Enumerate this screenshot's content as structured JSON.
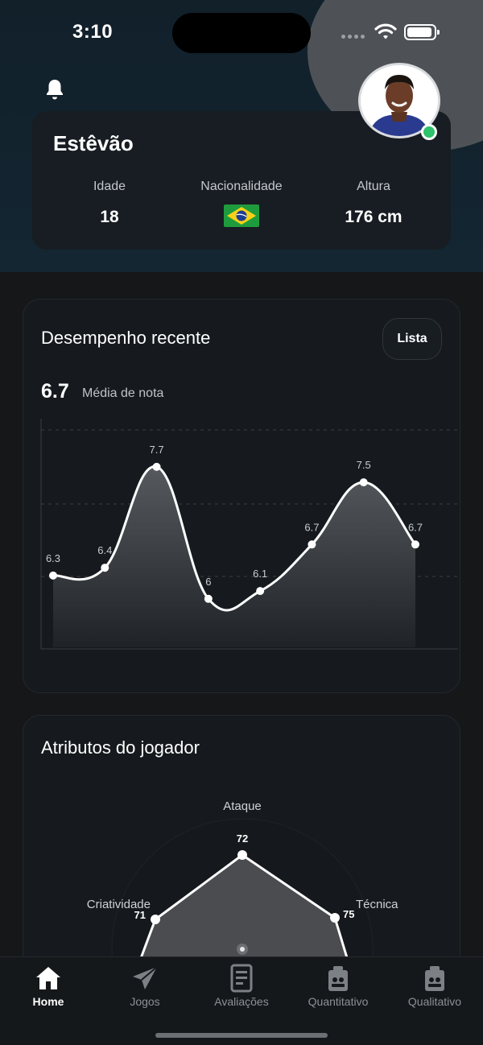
{
  "status_bar": {
    "time": "3:10"
  },
  "profile": {
    "name": "Estêvão",
    "stats": [
      {
        "label": "Idade",
        "value": "18"
      },
      {
        "label": "Nacionalidade",
        "value": "brazil-flag"
      },
      {
        "label": "Altura",
        "value": "176 cm"
      }
    ],
    "online": true
  },
  "performance": {
    "title": "Desempenho recente",
    "list_button": "Lista",
    "average_value": "6.7",
    "average_label": "Média de nota"
  },
  "chart_data": {
    "type": "line",
    "x": [
      1,
      2,
      3,
      4,
      5,
      6,
      7,
      8
    ],
    "values": [
      6.3,
      6.4,
      7.7,
      6,
      6.1,
      6.7,
      7.5,
      6.7
    ],
    "data_labels": [
      "6.3",
      "6.4",
      "7.7",
      "6",
      "6.1",
      "6.7",
      "7.5",
      "6.7"
    ],
    "title": "",
    "xlabel": "",
    "ylabel": "",
    "grid": true,
    "line_color": "#ffffff",
    "fill": "gradient"
  },
  "attributes": {
    "title": "Atributos do jogador",
    "axes": [
      {
        "label": "Ataque",
        "value": "72"
      },
      {
        "label": "Técnica",
        "value": "75"
      },
      {
        "label": "Criatividade",
        "value": "71"
      }
    ]
  },
  "nav": {
    "items": [
      {
        "label": "Home",
        "icon": "home-icon",
        "active": true
      },
      {
        "label": "Jogos",
        "icon": "paper-plane-icon",
        "active": false
      },
      {
        "label": "Avaliações",
        "icon": "document-icon",
        "active": false
      },
      {
        "label": "Quantitativo",
        "icon": "stats-icon",
        "active": false
      },
      {
        "label": "Qualitativo",
        "icon": "stats-icon",
        "active": false
      }
    ]
  },
  "colors": {
    "background": "#151719",
    "header": "#132632",
    "online": "#2ec26a",
    "accent": "#ffffff"
  }
}
